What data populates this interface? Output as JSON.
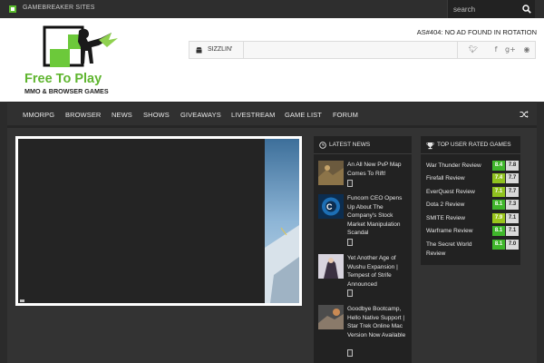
{
  "topbar": {
    "brand_label": "GAMEBREAKER SITES",
    "search_placeholder": "search"
  },
  "header": {
    "logo_title": "Free To Play",
    "logo_subtitle": "MMO & BROWSER GAMES",
    "ad_text": "AS#404: NO AD FOUND IN ROTATION",
    "ticker_label": "SIZZLIN'"
  },
  "social": [
    "twitter-icon",
    "facebook-icon",
    "google-plus-icon",
    "rss-icon"
  ],
  "nav": {
    "items": [
      "MMORPG",
      "BROWSER",
      "NEWS",
      "SHOWS",
      "GIVEAWAYS",
      "LIVESTREAM",
      "GAME LIST",
      "FORUM"
    ]
  },
  "latest_news": {
    "title": "LATEST NEWS",
    "items": [
      {
        "title": "An All New PvP Map Comes To Rift!"
      },
      {
        "title": "Funcom CEO Opens Up About The Company's Stock Market Manipulation Scandal"
      },
      {
        "title": "Yet Another Age of Wushu Expansion | Tempest of Strife Announced"
      },
      {
        "title": "Goodbye Bootcamp, Hello Native Support | Star Trek Online Mac Version Now Available"
      }
    ]
  },
  "top_rated": {
    "title": "TOP USER RATED GAMES",
    "items": [
      {
        "name": "War Thunder Review",
        "score_a": "8.4",
        "score_b": "7.8",
        "color_a": "#3fb62b"
      },
      {
        "name": "Firefall Review",
        "score_a": "7.4",
        "score_b": "7.7",
        "color_a": "#8fc21f"
      },
      {
        "name": "EverQuest Review",
        "score_a": "7.1",
        "score_b": "7.7",
        "color_a": "#8fc21f"
      },
      {
        "name": "Dota 2 Review",
        "score_a": "8.1",
        "score_b": "7.3",
        "color_a": "#3fb62b"
      },
      {
        "name": "SMITE Review",
        "score_a": "7.9",
        "score_b": "7.1",
        "color_a": "#9ac51b"
      },
      {
        "name": "Warframe Review",
        "score_a": "8.1",
        "score_b": "7.1",
        "color_a": "#3fb62b"
      },
      {
        "name": "The Secret World Review",
        "score_a": "8.1",
        "score_b": "7.0",
        "color_a": "#3fb62b"
      }
    ]
  },
  "colors": {
    "brand_green": "#5bbd2e",
    "nav_bg": "#303030",
    "widget_bg": "#222222"
  }
}
